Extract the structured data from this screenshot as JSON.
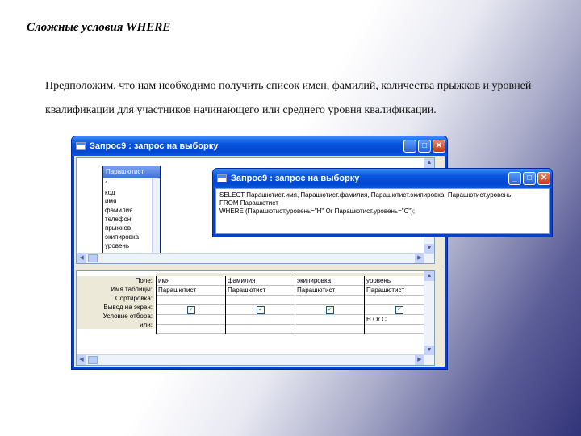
{
  "slide": {
    "title": "Сложные условия WHERE",
    "text": "Предположим, что нам необходимо получить список имен, фамилий, количества прыжков и уровней квалификации для участников начинающего или среднего уровня квалификации."
  },
  "query_window": {
    "title": "Запрос9 : запрос на выборку",
    "buttons": {
      "minimize": "_",
      "maximize": "□",
      "close": "✕"
    },
    "table": {
      "name": "Парашютист",
      "fields": [
        "*",
        "код",
        "имя",
        "фамилия",
        "телефон",
        "прыжков",
        "экипировка",
        "уровень"
      ]
    },
    "grid": {
      "row_labels": [
        "Поле:",
        "Имя таблицы:",
        "Сортировка:",
        "Вывод на экран:",
        "Условие отбора:",
        "или:"
      ],
      "columns": [
        {
          "field": "имя",
          "table": "Парашютист",
          "sort": "",
          "show": "✓",
          "criteria": "",
          "or": ""
        },
        {
          "field": "фамилия",
          "table": "Парашютист",
          "sort": "",
          "show": "✓",
          "criteria": "",
          "or": ""
        },
        {
          "field": "экипировка",
          "table": "Парашютист",
          "sort": "",
          "show": "✓",
          "criteria": "",
          "or": ""
        },
        {
          "field": "уровень",
          "table": "Парашютист",
          "sort": "",
          "show": "✓",
          "criteria": "Н Or С",
          "or": ""
        }
      ]
    }
  },
  "sql_window": {
    "title": "Запрос9 : запрос на выборку",
    "buttons": {
      "minimize": "_",
      "maximize": "□",
      "close": "✕"
    },
    "sql_lines": [
      "SELECT Парашютист.имя, Парашютист.фамилия, Парашютист.экипировка, Парашютист.уровень",
      "FROM Парашютист",
      "WHERE (Парашютист.уровень=\"Н\" Or Парашютист.уровень=\"С\");"
    ]
  },
  "colors": {
    "title_bar": "#0a58e0",
    "close_button": "#c73a14",
    "client": "#ece9d8"
  }
}
